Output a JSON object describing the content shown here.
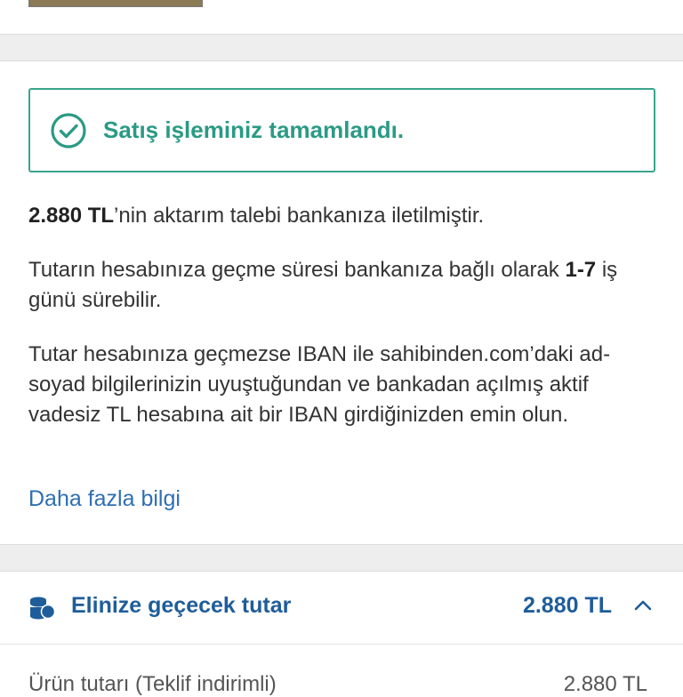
{
  "colors": {
    "success": "#2b9a84",
    "success_border": "#3aa58e",
    "link": "#2f6fb3",
    "accent_blue": "#1f5d9a",
    "text": "#333333",
    "band": "#eeeeee"
  },
  "success": {
    "icon": "check-circle-icon",
    "message": "Satış işleminiz tamamlandı."
  },
  "transfer": {
    "amount": "2.880 TL",
    "amount_suffix": "’nin aktarım talebi bankanıza iletilmiştir."
  },
  "duration": {
    "text_before": "Tutarın hesabınıza geçme süresi bankanıza bağlı olarak ",
    "days": "1-7",
    "text_after": " iş günü sürebilir."
  },
  "warning": {
    "text": "Tutar hesabınıza geçmezse IBAN ile sahibinden.com’daki ad-soyad bilgilerinizin uyuştuğundan ve bankadan açılmış aktif vadesiz TL hesabına ait bir IBAN girdiğinizden emin olun."
  },
  "more_info_link": "Daha fazla bilgi",
  "summary": {
    "icon": "coins-icon",
    "label": "Elinize geçecek tutar",
    "amount": "2.880 TL",
    "toggle_icon": "chevron-up-icon"
  },
  "breakdown": {
    "label": "Ürün tutarı (Teklif indirimli)",
    "value": "2.880 TL"
  }
}
